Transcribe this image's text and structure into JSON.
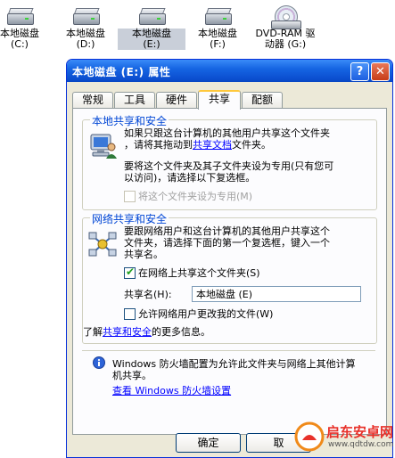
{
  "desktop": {
    "icons": [
      {
        "label": "本地磁盘\n(C:)"
      },
      {
        "label": "本地磁盘\n(D:)"
      },
      {
        "label": "本地磁盘\n(E:)"
      },
      {
        "label": "本地磁盘\n(F:)"
      },
      {
        "label": "DVD-RAM 驱\n动器 (G:)"
      }
    ]
  },
  "dialog": {
    "title": "本地磁盘 (E:) 属性",
    "help": "?",
    "close": "✕",
    "tabs": [
      "常规",
      "工具",
      "硬件",
      "共享",
      "配额"
    ],
    "local": {
      "title": "本地共享和安全",
      "line1": "如果只跟这台计算机的其他用户共享这个文件夹",
      "line2_prefix": "，请将其拖动到",
      "link": "共享文档",
      "line2_suffix": "文件夹。",
      "line3": "要将这个文件夹及其子文件夹设为专用(只有您可",
      "line4": "以访问)，请选择以下复选框。",
      "checkbox": "将这个文件夹设为专用(M)"
    },
    "network": {
      "title": "网络共享和安全",
      "line1": "要跟网络用户和这台计算机的其他用户共享这个",
      "line2": "文件夹，请选择下面的第一个复选框，键入一个",
      "line3": "共享名。",
      "share_checkbox": "在网络上共享这个文件夹(S)",
      "share_name_label": "共享名(H):",
      "share_name_value": "本地磁盘 (E)",
      "allow_checkbox": "允许网络用户更改我的文件(W)",
      "learn_prefix": "了解",
      "learn_link": "共享和安全",
      "learn_suffix": "的更多信息。"
    },
    "firewall": {
      "line1": "Windows 防火墙配置为允许此文件夹与网络上其他计算",
      "line2": "机共享。",
      "link": "查看 Windows 防火墙设置"
    },
    "buttons": {
      "ok": "确定",
      "cancel": "取"
    },
    "checked_mark": "✔"
  },
  "watermark": {
    "name": "启东安卓网",
    "url": "www.qdtdw.com"
  }
}
